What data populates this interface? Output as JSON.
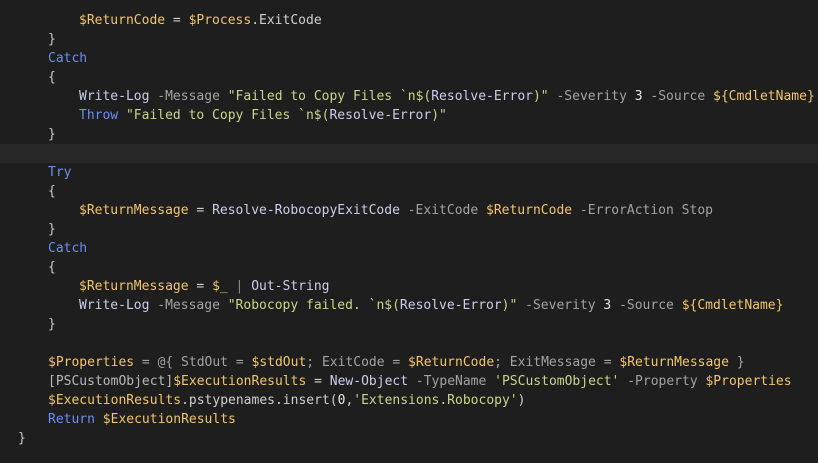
{
  "editor": {
    "language": "PowerShell",
    "lines": [
      [
        "$ReturnCode",
        " = ",
        "$Process",
        ".ExitCode"
      ],
      [
        "}"
      ],
      [
        "Catch"
      ],
      [
        "{"
      ],
      [
        "Write-Log",
        " -Message ",
        "\"Failed to Copy Files `n$(",
        "Resolve-Error",
        ")\"",
        " -Severity ",
        "3",
        " -Source ",
        "${",
        "CmdletName",
        "}"
      ],
      [
        "Throw",
        " ",
        "\"Failed to Copy Files `n$(",
        "Resolve-Error",
        ")\""
      ],
      [
        "}"
      ],
      [
        ""
      ],
      [
        "Try"
      ],
      [
        "{"
      ],
      [
        "$ReturnMessage",
        " = ",
        "Resolve-RobocopyExitCode",
        " -ExitCode ",
        "$ReturnCode",
        " -ErrorAction Stop"
      ],
      [
        "}"
      ],
      [
        "Catch"
      ],
      [
        "{"
      ],
      [
        "$ReturnMessage",
        " = ",
        "$_",
        " | ",
        "Out-String"
      ],
      [
        "Write-Log",
        " -Message ",
        "\"Robocopy failed. `n$(",
        "Resolve-Error",
        ")\"",
        " -Severity ",
        "3",
        " -Source ",
        "${",
        "CmdletName",
        "}"
      ],
      [
        "}"
      ],
      [
        ""
      ],
      [
        "$Properties",
        " = @{ StdOut = ",
        "$stdOut",
        "; ExitCode = ",
        "$ReturnCode",
        "; ExitMessage = ",
        "$ReturnMessage",
        " }"
      ],
      [
        "[PSCustomObject]",
        "$ExecutionResults",
        " = ",
        "New-Object",
        " -TypeName ",
        "'PSCustomObject'",
        " -Property ",
        "$Properties"
      ],
      [
        "$ExecutionResults",
        ".pstypenames.insert(",
        "0",
        ",",
        "'Extensions.Robocopy'",
        ")"
      ],
      [
        "Return",
        " ",
        "$ExecutionResults"
      ],
      [
        "}"
      ]
    ]
  }
}
